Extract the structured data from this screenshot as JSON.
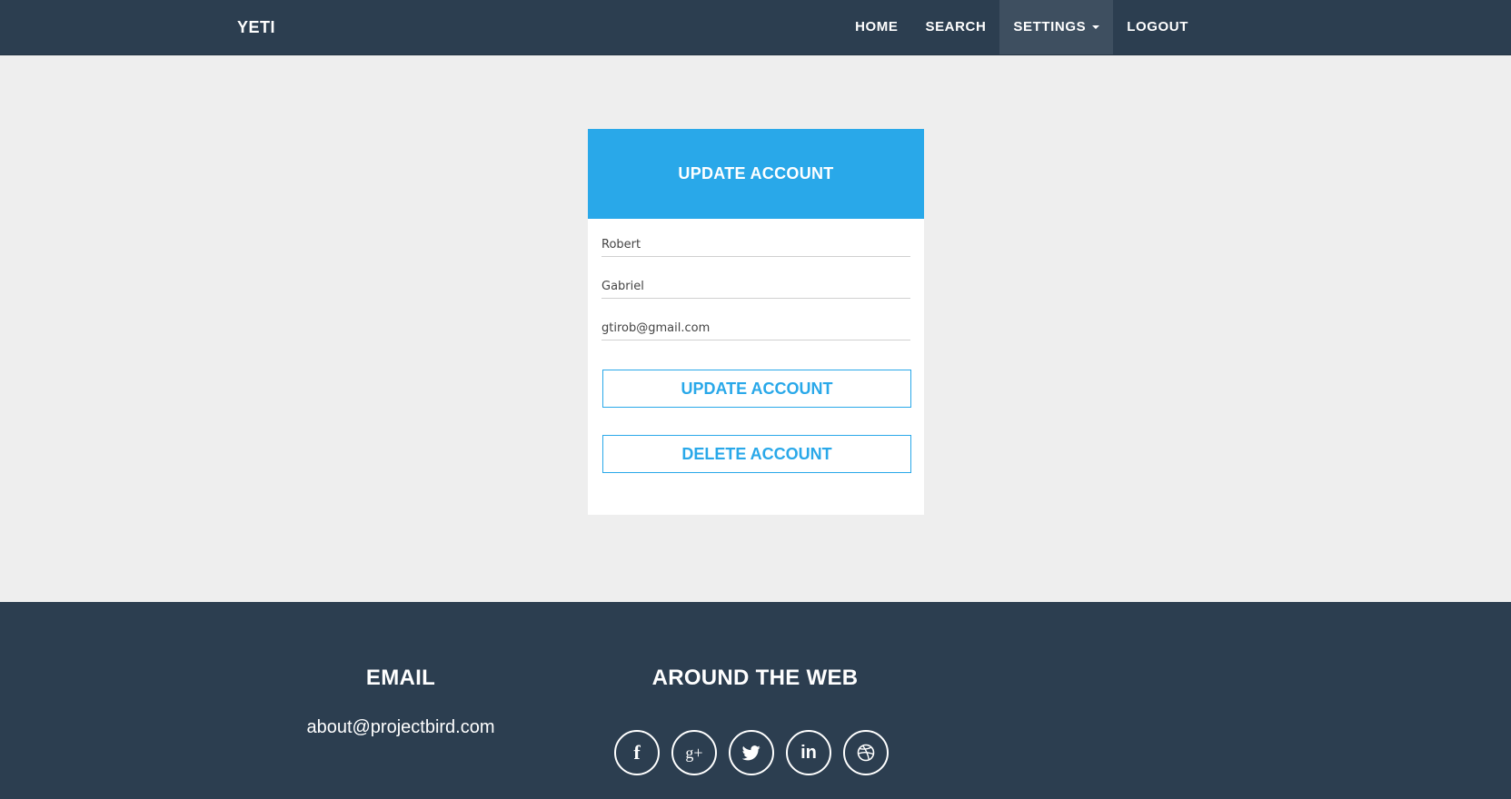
{
  "nav": {
    "brand": "YETI",
    "links": [
      {
        "label": "HOME"
      },
      {
        "label": "SEARCH"
      },
      {
        "label": "SETTINGS"
      },
      {
        "label": "LOGOUT"
      }
    ]
  },
  "form": {
    "title": "UPDATE ACCOUNT",
    "first_name": "Robert",
    "last_name": "Gabriel",
    "email": "gtirob@gmail.com",
    "update_label": "UPDATE ACCOUNT",
    "delete_label": "DELETE ACCOUNT"
  },
  "footer": {
    "email_heading": "EMAIL",
    "email_value": "about@projectbird.com",
    "web_heading": "AROUND THE WEB",
    "socials": [
      {
        "icon": "facebook-icon",
        "glyph": "f"
      },
      {
        "icon": "google-plus-icon",
        "glyph": "g+"
      },
      {
        "icon": "twitter-icon",
        "glyph": ""
      },
      {
        "icon": "linkedin-icon",
        "glyph": "in"
      },
      {
        "icon": "dribbble-icon",
        "glyph": ""
      }
    ]
  },
  "colors": {
    "navbar": "#2c3e50",
    "accent": "#29a8e9",
    "background": "#eeeeee"
  }
}
